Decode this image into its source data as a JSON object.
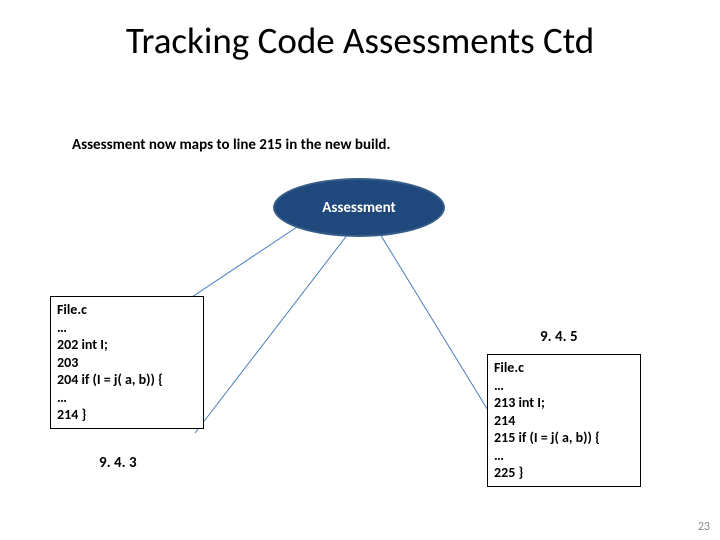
{
  "title": "Tracking Code Assessments Ctd",
  "subtitle": "Assessment now maps to line 215 in the new build.",
  "assessment_label": "Assessment",
  "left_box": {
    "filename": "File.c",
    "lines": "…\n202 int I;\n203\n204 if (I = j( a, b)) {\n…\n214 }"
  },
  "right_box": {
    "filename": "File.c",
    "lines": "…\n213 int I;\n214\n215 if (I = j( a, b)) {\n…\n225 }"
  },
  "version_left": "9. 4. 3",
  "version_right": "9. 4. 5",
  "page_number": "23"
}
